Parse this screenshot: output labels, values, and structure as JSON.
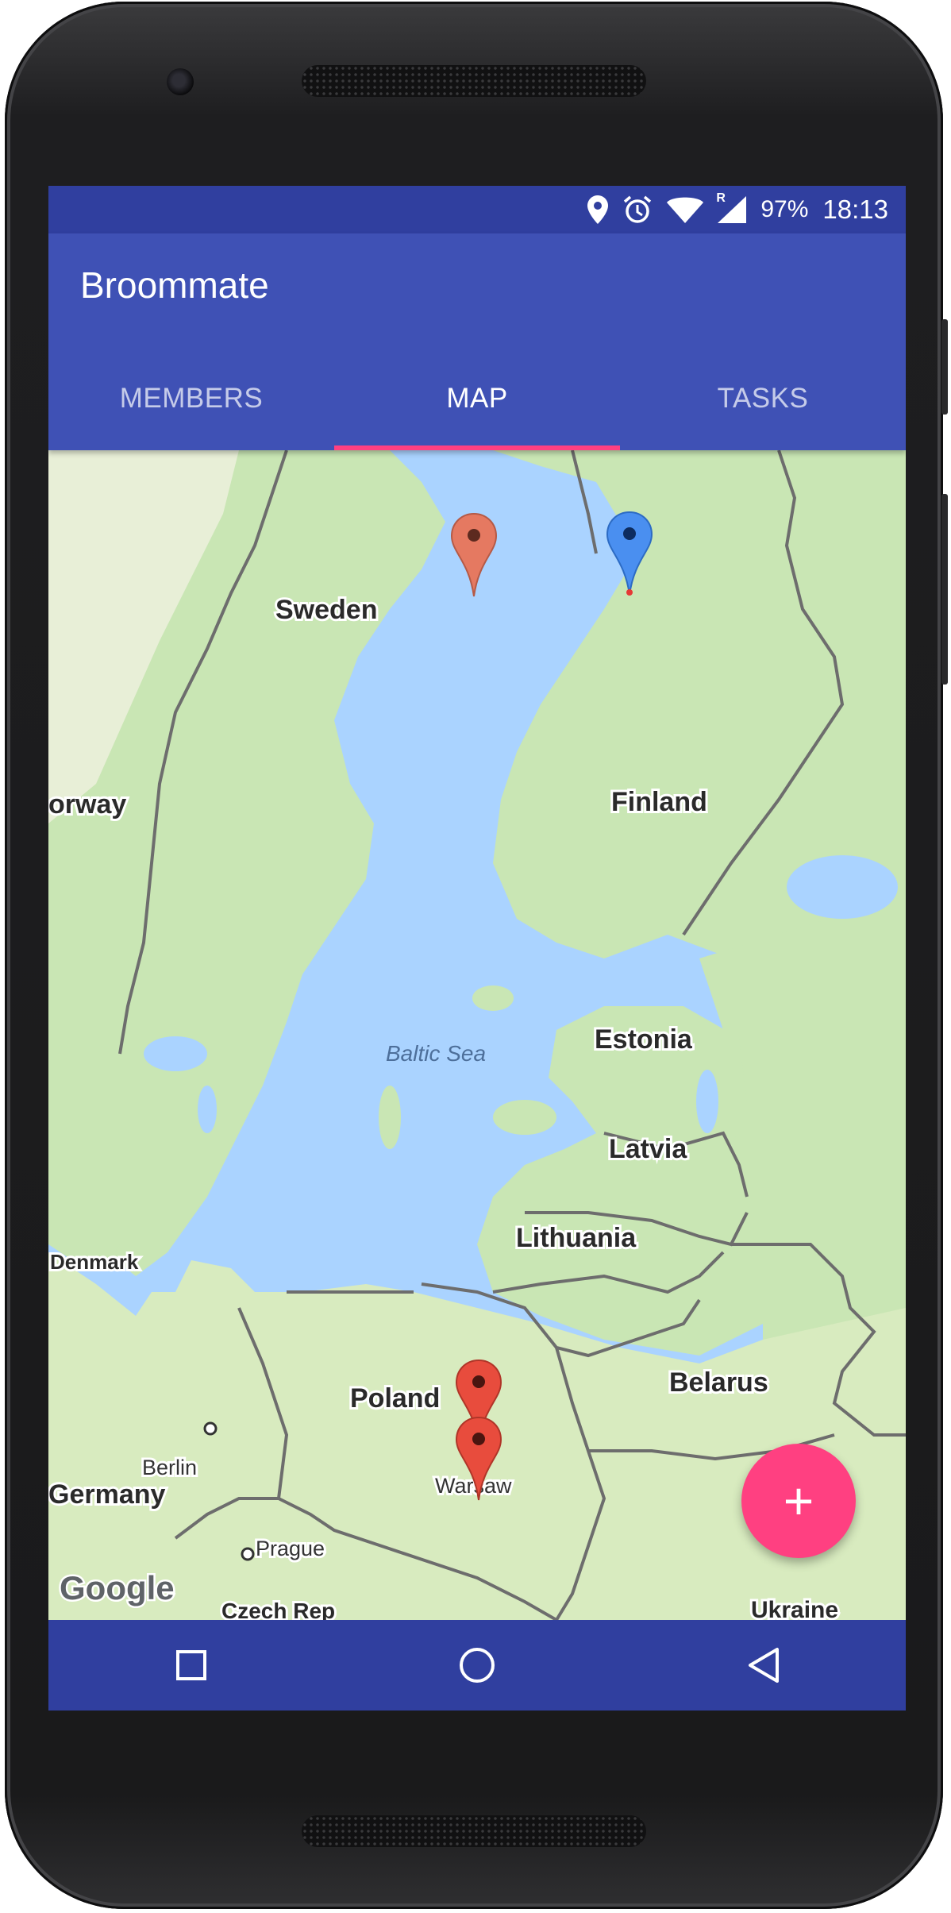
{
  "status_bar": {
    "icons": [
      "location-icon",
      "alarm-icon",
      "wifi-icon",
      "cell-signal-icon"
    ],
    "roaming": "R",
    "battery": "97%",
    "time": "18:13"
  },
  "app_bar": {
    "title": "Broommate",
    "tabs": [
      {
        "label": "MEMBERS",
        "active": false
      },
      {
        "label": "MAP",
        "active": true
      },
      {
        "label": "TASKS",
        "active": false
      }
    ]
  },
  "map": {
    "labels": {
      "sweden": "Sweden",
      "norway": "orway",
      "finland": "Finland",
      "baltic_sea": "Baltic Sea",
      "estonia": "Estonia",
      "latvia": "Latvia",
      "lithuania": "Lithuania",
      "denmark": "Denmark",
      "belarus": "Belarus",
      "poland": "Poland",
      "berlin": "Berlin",
      "germany": "Germany",
      "warsaw": "Warsaw",
      "prague": "Prague",
      "czech": "Czech Rep",
      "ukraine": "Ukraine"
    },
    "attribution": "Google",
    "markers": [
      {
        "name": "marker-sweden",
        "color": "#e57961"
      },
      {
        "name": "marker-finland",
        "color": "#4a8ff0"
      },
      {
        "name": "marker-warsaw-1",
        "color": "#e84c3d"
      },
      {
        "name": "marker-warsaw-2",
        "color": "#e84c3d"
      }
    ],
    "colors": {
      "water": "#aad3ff",
      "land": "#c7e5b2",
      "border": "#6b6b6b"
    }
  },
  "fab": {
    "label": "+",
    "icon": "add-icon"
  },
  "nav_bar": {
    "icons": [
      "recents-icon",
      "home-icon",
      "back-icon"
    ]
  },
  "theme": {
    "primary": "#3f51b5",
    "primary_dark": "#303f9f",
    "accent": "#ff4081"
  }
}
